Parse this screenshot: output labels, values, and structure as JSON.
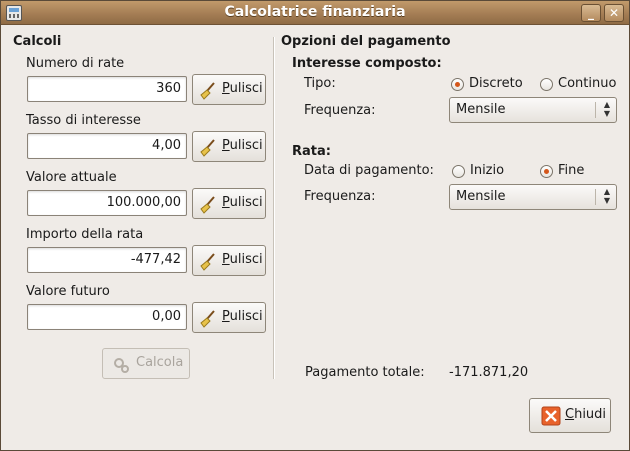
{
  "window": {
    "title": "Calcolatrice finanziaria"
  },
  "calcoli": {
    "title": "Calcoli",
    "fields": [
      {
        "label": "Numero di rate",
        "value": "360"
      },
      {
        "label": "Tasso di interesse",
        "value": "4,00"
      },
      {
        "label": "Valore attuale",
        "value": "100.000,00"
      },
      {
        "label": "Importo della rata",
        "value": "-477,42"
      },
      {
        "label": "Valore futuro",
        "value": "0,00"
      }
    ],
    "clear_label": "Pulisci",
    "calc_label": "Calcola"
  },
  "opzioni": {
    "title": "Opzioni del pagamento",
    "interesse": {
      "title": "Interesse composto:",
      "tipo_label": "Tipo:",
      "discreto": "Discreto",
      "continuo": "Continuo",
      "selected": "Discreto",
      "frequenza_label": "Frequenza:",
      "frequenza_value": "Mensile"
    },
    "rata": {
      "title": "Rata:",
      "data_label": "Data di pagamento:",
      "inizio": "Inizio",
      "fine": "Fine",
      "selected": "Fine",
      "frequenza_label": "Frequenza:",
      "frequenza_value": "Mensile"
    },
    "totale_label": "Pagamento totale:",
    "totale_value": "-171.871,20"
  },
  "footer": {
    "close_label": "Chiudi"
  }
}
